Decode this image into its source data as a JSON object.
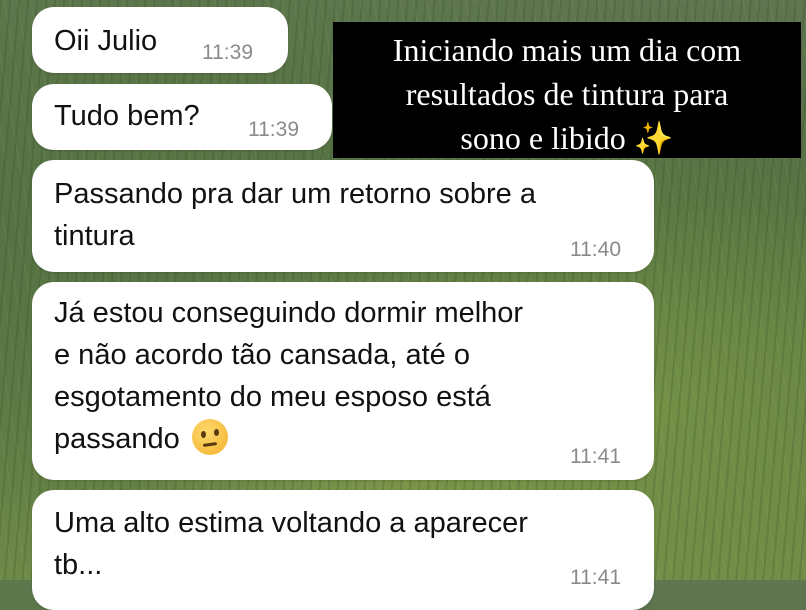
{
  "caption": {
    "line1": "Iniciando mais um dia com",
    "line2": "resultados de tintura para",
    "line3": "sono e libido",
    "sparkle": "✨"
  },
  "messages": [
    {
      "text": "Oii Julio",
      "time": "11:39"
    },
    {
      "text": "Tudo bem?",
      "time": "11:39"
    },
    {
      "line1": "Passando pra dar um retorno sobre a",
      "line2": "tintura",
      "time": "11:40"
    },
    {
      "line1": "Já estou conseguindo dormir melhor",
      "line2": "e não acordo tão cansada, até o",
      "line3": "esgotamento do meu esposo está",
      "line4": "passando",
      "emoji": "thinking-face",
      "time": "11:41"
    },
    {
      "line1": "Uma alto estima voltando a aparecer",
      "line2": "tb...",
      "time": "11:41"
    }
  ]
}
